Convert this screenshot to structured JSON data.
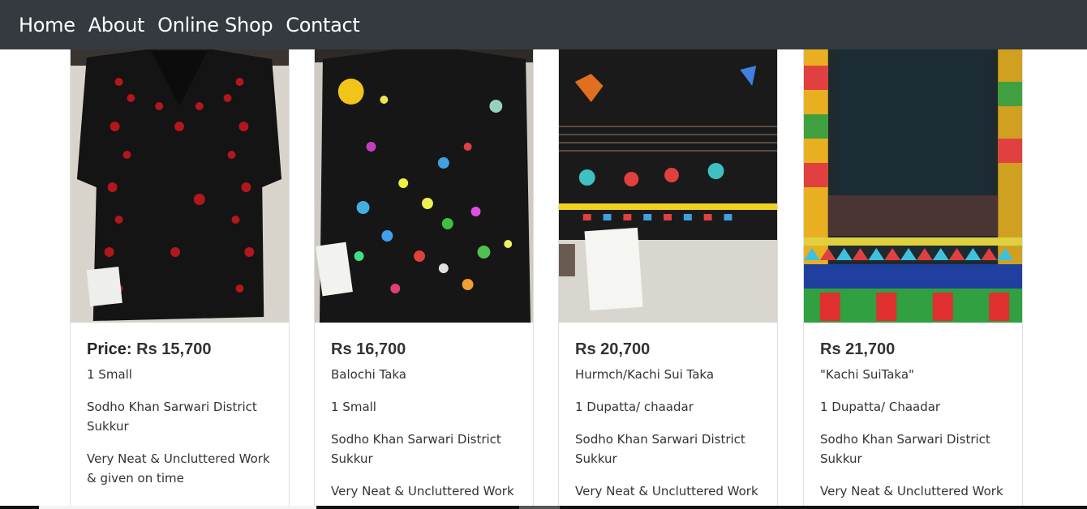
{
  "nav": {
    "items": [
      {
        "label": "Home"
      },
      {
        "label": "About"
      },
      {
        "label": "Online Shop"
      },
      {
        "label": "Contact"
      }
    ]
  },
  "products": [
    {
      "price_label": "Price:",
      "price": "Rs 15,700",
      "lines": [
        "1 Small",
        "Sodho Khan Sarwari District Sukkur",
        "Very Neat & Uncluttered Work & given on time"
      ]
    },
    {
      "price_label": "",
      "price": "Rs 16,700",
      "lines": [
        "Balochi Taka",
        "1 Small",
        "Sodho Khan Sarwari District Sukkur",
        "Very Neat & Uncluttered Work"
      ]
    },
    {
      "price_label": "",
      "price": "Rs 20,700",
      "lines": [
        "Hurmch/Kachi Sui Taka",
        "1 Dupatta/ chaadar",
        "Sodho Khan Sarwari District Sukkur",
        "Very Neat & Uncluttered Work"
      ]
    },
    {
      "price_label": "",
      "price": "Rs 21,700",
      "lines": [
        "\"Kachi SuiTaka\"",
        "1 Dupatta/ Chaadar",
        "Sodho Khan Sarwari District Sukkur",
        "Very Neat & Uncluttered Work"
      ]
    }
  ],
  "colors": {
    "navbar_bg": "#343a40",
    "nav_text": "#ffffff",
    "card_border": "#e0e0e0"
  }
}
